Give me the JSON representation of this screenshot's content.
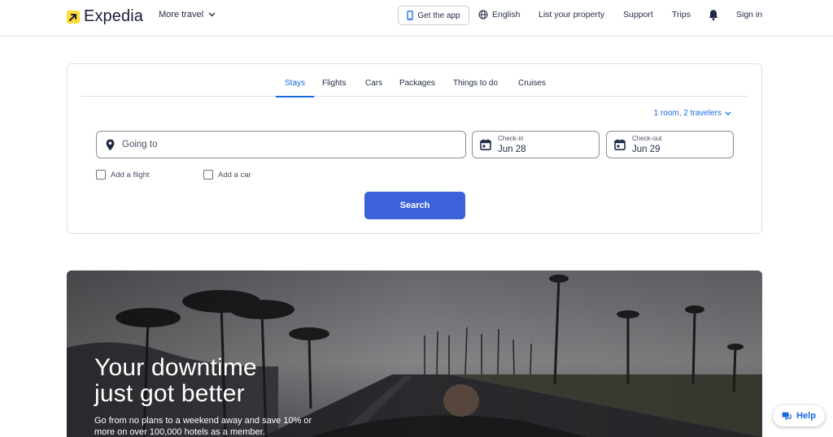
{
  "brand": {
    "name": "Expedia",
    "logo_color": "#fddb32"
  },
  "header": {
    "more_travel": "More travel",
    "get_app": "Get the app",
    "language": "English",
    "list_property": "List your property",
    "support": "Support",
    "trips": "Trips",
    "sign_in": "Sign in"
  },
  "search": {
    "tabs": [
      {
        "label": "Stays",
        "active": true
      },
      {
        "label": "Flights",
        "active": false
      },
      {
        "label": "Cars",
        "active": false
      },
      {
        "label": "Packages",
        "active": false
      },
      {
        "label": "Things to do",
        "active": false
      },
      {
        "label": "Cruises",
        "active": false
      }
    ],
    "travelers": "1 room, 2 travelers",
    "going_to_placeholder": "Going to",
    "check_in": {
      "label": "Check-in",
      "value": "Jun 28"
    },
    "check_out": {
      "label": "Check-out",
      "value": "Jun 29"
    },
    "add_flight": "Add a flight",
    "add_car": "Add a car",
    "search_button": "Search",
    "accent_color": "#1668e3",
    "button_color": "#3b62d9"
  },
  "hero": {
    "title_line1": "Your downtime",
    "title_line2": "just got better",
    "subtitle": "Go from no plans to a weekend away and save 10% or more on over 100,000 hotels as a member."
  },
  "help": {
    "label": "Help"
  },
  "icons": {
    "logo": "arrow-up-right-icon",
    "phone": "phone-icon",
    "globe": "globe-icon",
    "bell": "bell-icon",
    "pin": "map-pin-icon",
    "calendar": "calendar-icon",
    "chevron": "chevron-down-icon",
    "chat": "chat-bubble-icon"
  }
}
